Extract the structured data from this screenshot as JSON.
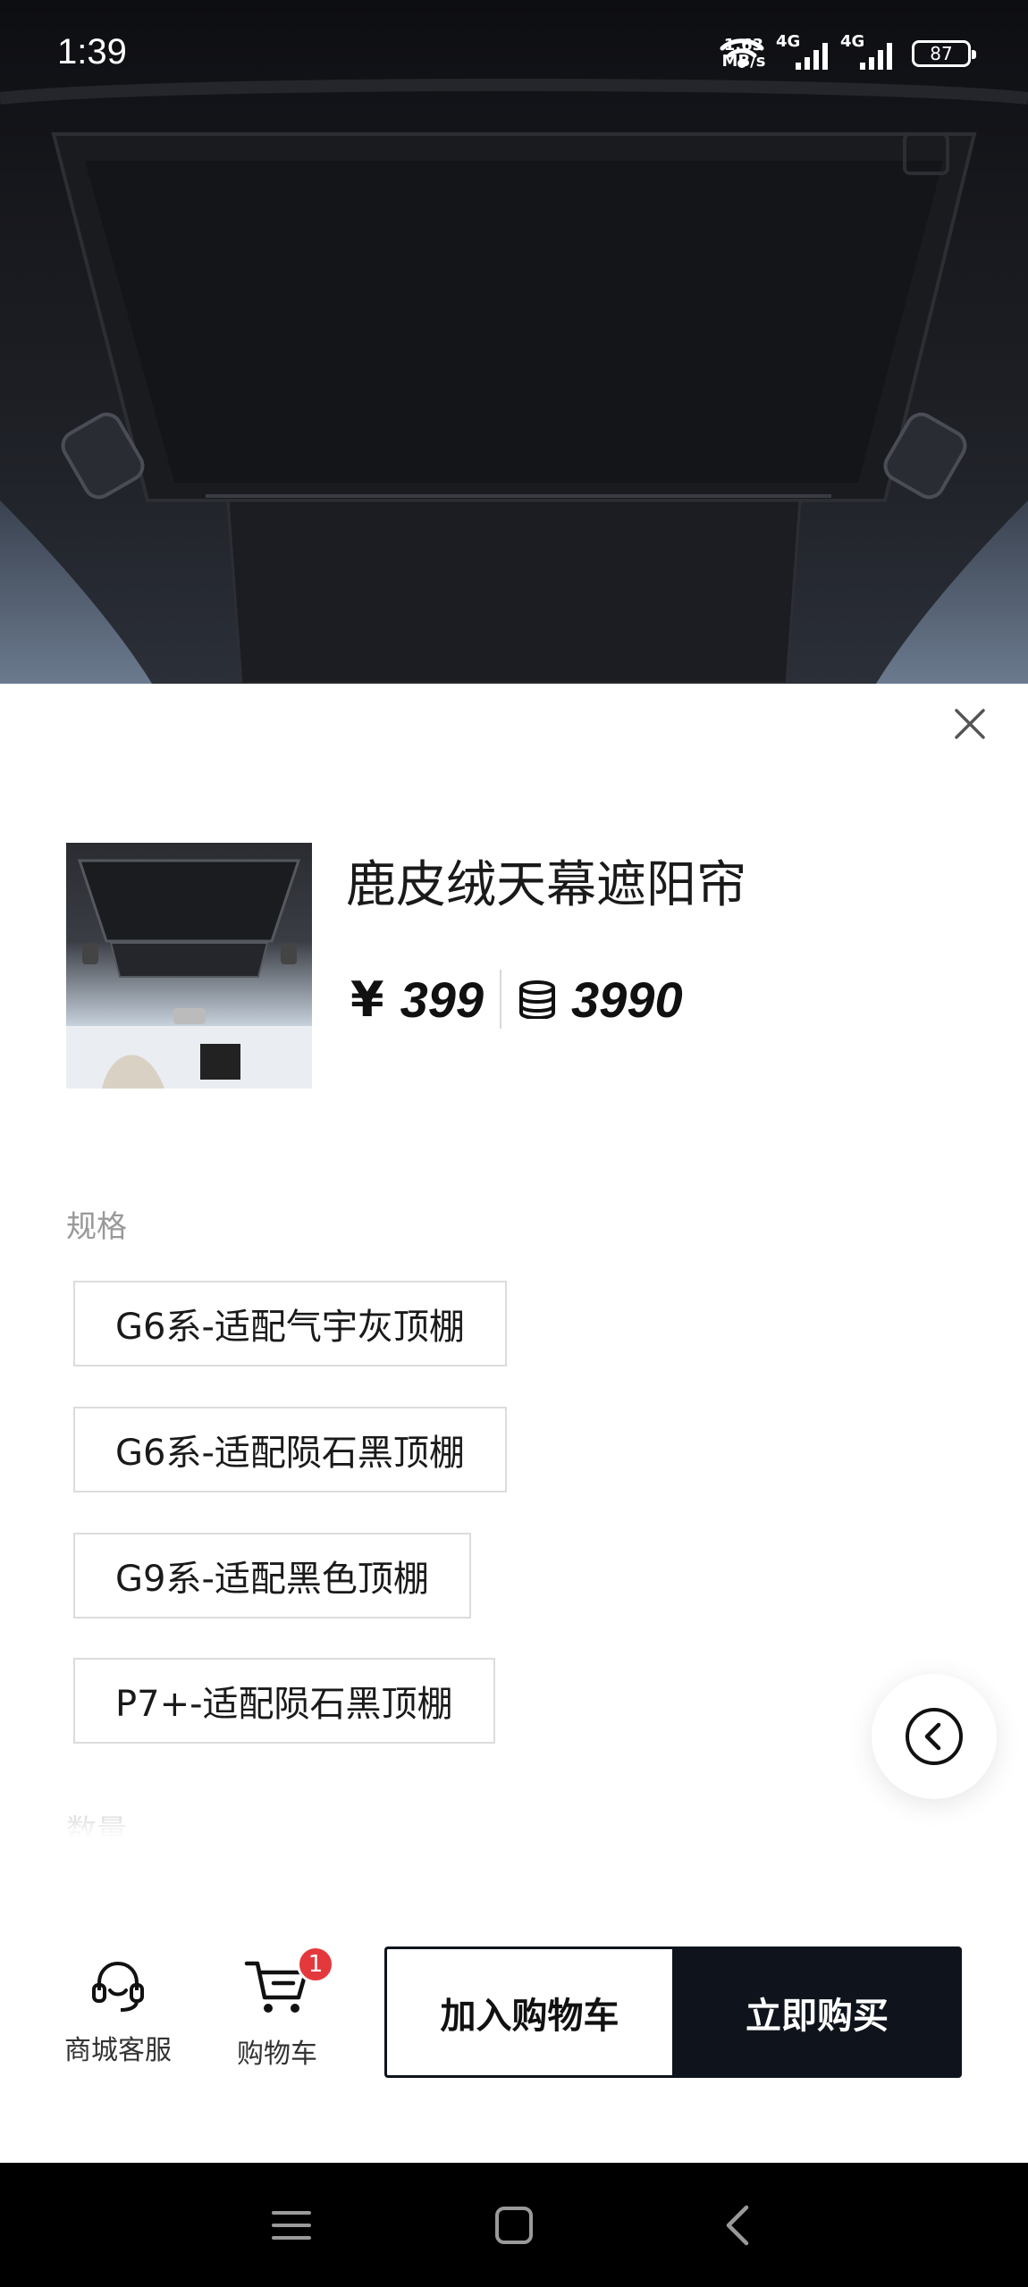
{
  "status_bar": {
    "time": "1:39",
    "net_speed_value": "1.63",
    "net_speed_unit": "MB/s",
    "signal_1_label": "4G",
    "signal_2_label": "4G",
    "battery": "87"
  },
  "product": {
    "name": "鹿皮绒天幕遮阳帘",
    "currency_symbol": "¥",
    "price": "399",
    "points": "3990"
  },
  "spec": {
    "label": "规格",
    "options": [
      "G6系-适配气宇灰顶棚",
      "G6系-适配陨石黑顶棚",
      "G9系-适配黑色顶棚",
      "P7+-适配陨石黑顶棚"
    ]
  },
  "quantity": {
    "label": "数量"
  },
  "bottom_bar": {
    "service_label": "商城客服",
    "cart_label": "购物车",
    "cart_badge": "1",
    "add_to_cart": "加入购物车",
    "buy_now": "立即购买"
  },
  "colors": {
    "primary_dark": "#0f141c",
    "badge_red": "#e4393c",
    "muted_text": "#999999",
    "border": "#dcdcdc"
  }
}
